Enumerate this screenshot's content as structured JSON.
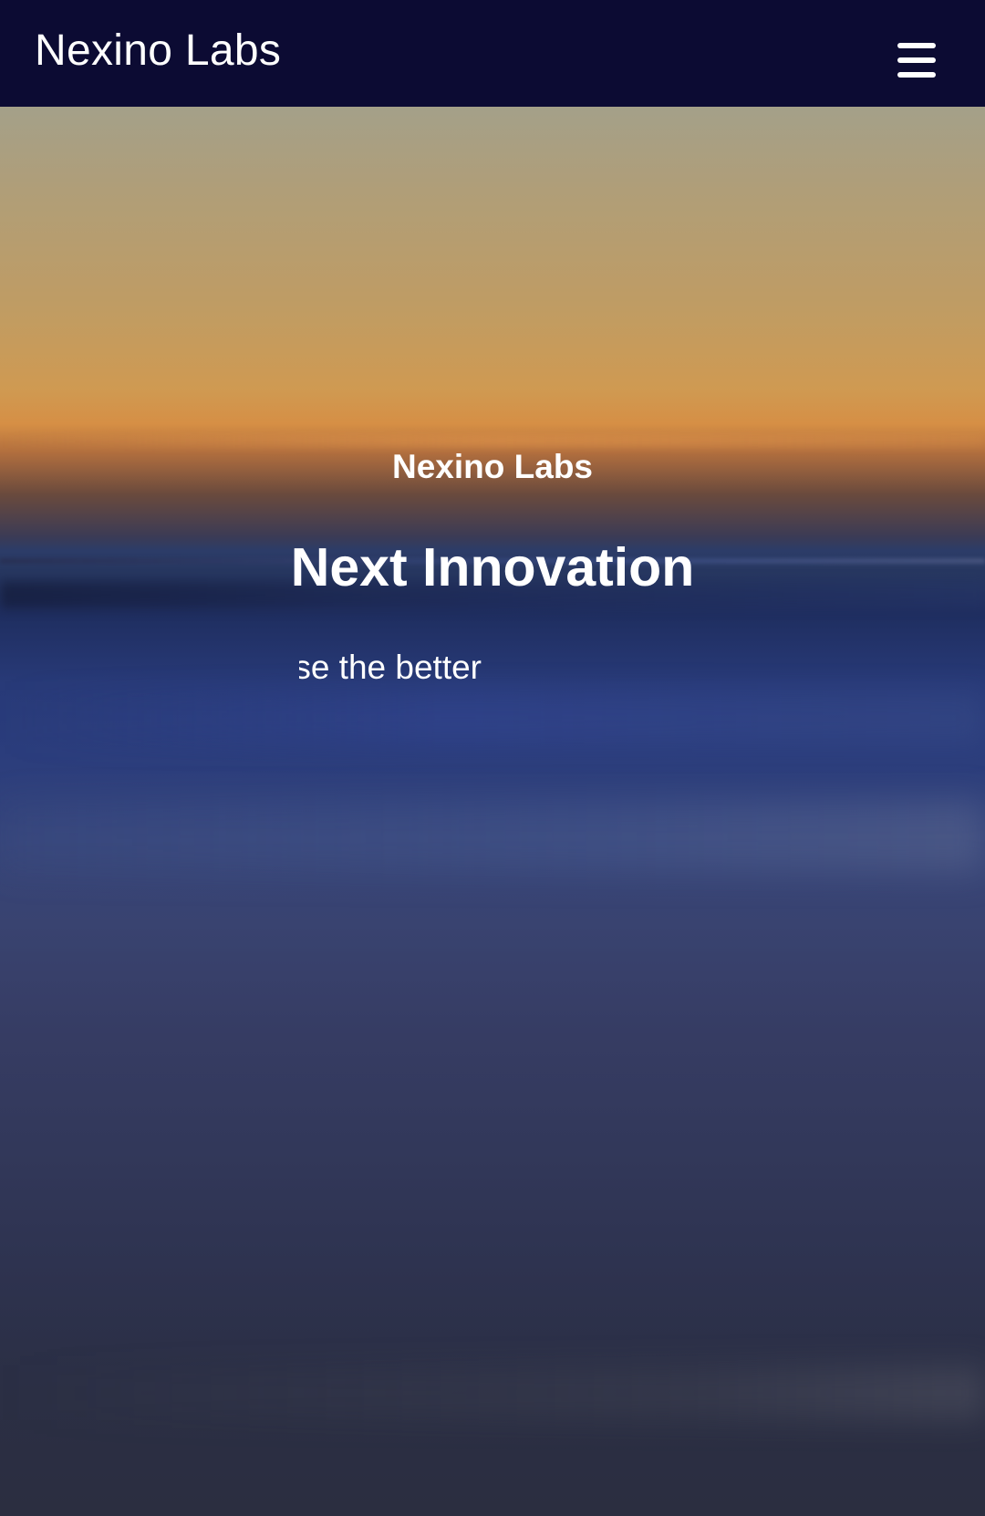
{
  "navbar": {
    "brand": "Nexino Labs",
    "menu_icon": "hamburger-menu-icon"
  },
  "hero": {
    "kicker": "Nexino Labs",
    "title": "Next Innovation",
    "typed_text": "Choose the better",
    "background": "blurred ocean sunset photo"
  },
  "colors": {
    "navbar_bg": "#0c0b33",
    "text": "#ffffff"
  }
}
